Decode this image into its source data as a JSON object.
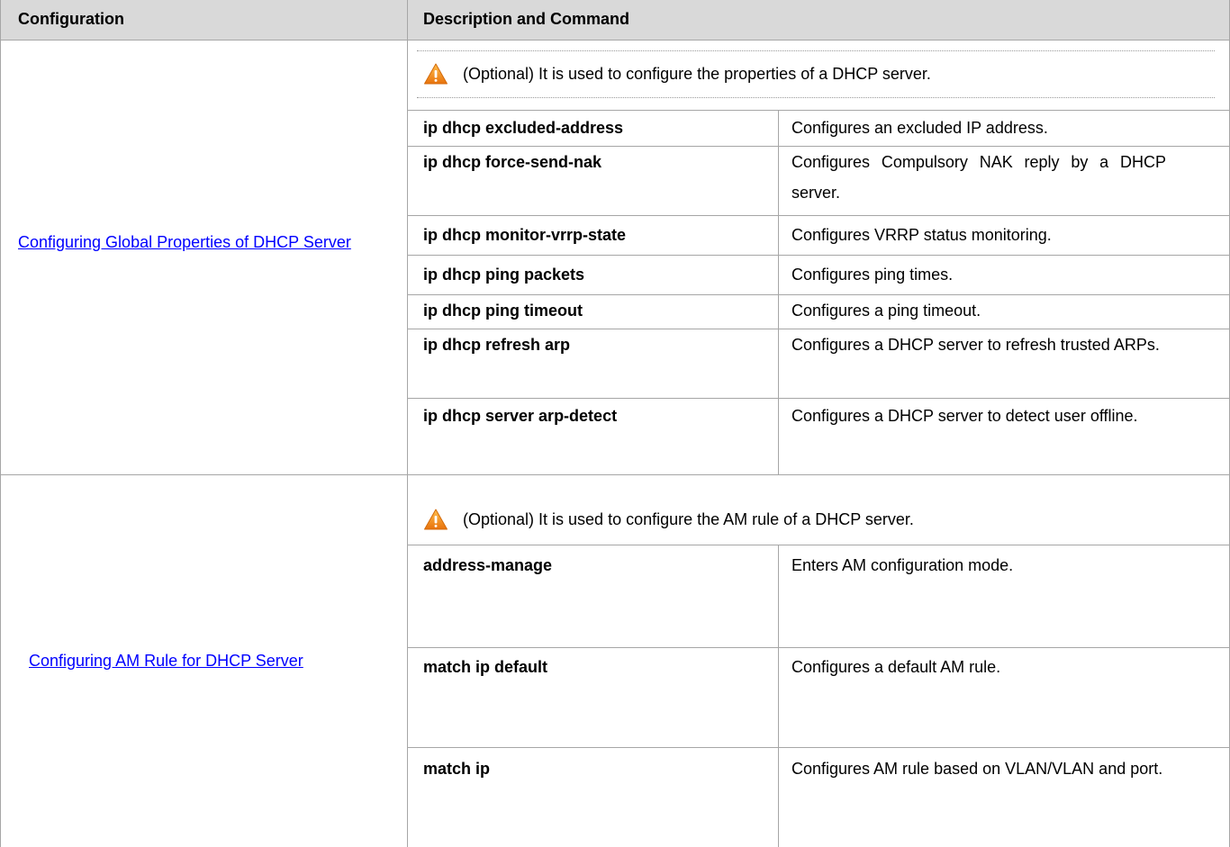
{
  "header": {
    "configuration": "Configuration",
    "description": "Description and Command"
  },
  "sections": [
    {
      "link": "Configuring Global Properties of DHCP Server",
      "note": "(Optional) It is used to configure the properties of a DHCP server.",
      "rows": [
        {
          "command": "ip dhcp excluded-address",
          "description": "Configures an excluded IP address."
        },
        {
          "command": "ip dhcp force-send-nak",
          "description": "Configures Compulsory NAK reply by a DHCP server."
        },
        {
          "command": "ip dhcp monitor-vrrp-state",
          "description": "Configures VRRP status monitoring."
        },
        {
          "command": "ip dhcp ping packets",
          "description": "Configures ping times."
        },
        {
          "command": "ip dhcp ping timeout",
          "description": "Configures a ping timeout."
        },
        {
          "command": "ip dhcp refresh arp",
          "description": "Configures a DHCP server to refresh trusted ARPs."
        },
        {
          "command": "ip dhcp server arp-detect",
          "description": "Configures a DHCP server to detect user offline."
        }
      ]
    },
    {
      "link": "Configuring AM Rule for DHCP Server",
      "note": "(Optional) It is used to configure the AM rule of a DHCP server.",
      "rows": [
        {
          "command": "address-manage",
          "description": "Enters AM configuration mode."
        },
        {
          "command": "match ip default",
          "description": "Configures a default AM rule."
        },
        {
          "command": "match ip",
          "description": "Configures AM rule based on VLAN/VLAN and port."
        }
      ]
    }
  ],
  "icons": {
    "note": "warning-icon"
  },
  "colors": {
    "header_bg": "#d9d9d9",
    "link": "#0000ff",
    "warning": "#f39c12"
  }
}
